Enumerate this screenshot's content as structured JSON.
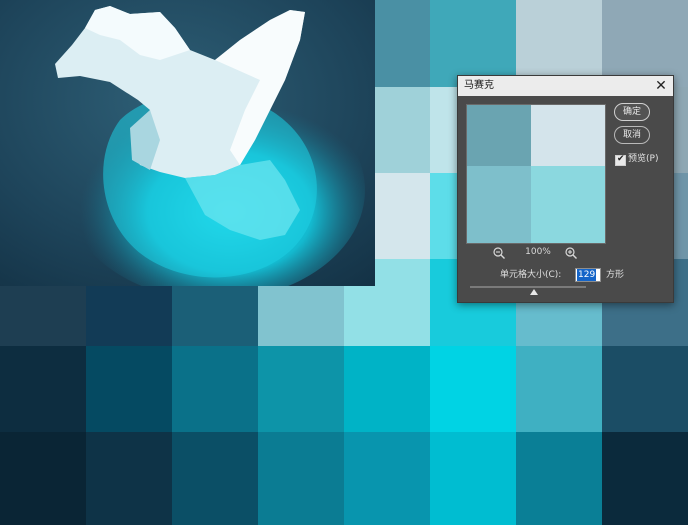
{
  "dialog": {
    "title": "马赛克",
    "ok_label": "确定",
    "cancel_label": "取消",
    "preview_checkbox": {
      "label": "预览(P)",
      "checked": true
    },
    "zoom_level": "100%",
    "cell_size": {
      "label": "单元格大小(C):",
      "value": "129",
      "unit": "方形"
    },
    "slider": {
      "fraction": 0.55
    }
  },
  "icons": {
    "close": "close-icon",
    "zoom_out": "zoom-out-icon",
    "zoom_in": "zoom-in-icon",
    "checkmark": "checkmark-icon"
  },
  "canvas": {
    "mosaic_colors": [
      [
        "#3a6a7e",
        "#2f6478",
        "#2f6478",
        "#3a7a8c",
        "#4a90a4",
        "#3fa8b9",
        "#bad0d8",
        "#8fa8b6"
      ],
      [
        "#30596c",
        "#2c5a70",
        "#2d6175",
        "#3a7586",
        "#9fd1d9",
        "#bfe4ea",
        "#6ac9d6",
        "#8ea7b3"
      ],
      [
        "#2a4f63",
        "#2a5368",
        "#2c5d72",
        "#418090",
        "#d4e6ec",
        "#5ddde9",
        "#75c9d6",
        "#6f95a8"
      ],
      [
        "#1e3e52",
        "#123b56",
        "#1b5f77",
        "#81c3cf",
        "#92e0e6",
        "#18cbdc",
        "#66bccd",
        "#3d6f88"
      ],
      [
        "#0d2d40",
        "#054a62",
        "#0a7189",
        "#0d94a8",
        "#00b3c6",
        "#00d3e4",
        "#3fb0c2",
        "#1b4d65"
      ],
      [
        "#0a2535",
        "#0e3347",
        "#0b4f66",
        "#0b7c93",
        "#0895ae",
        "#00bdd1",
        "#0a7f96",
        "#0b2a3c"
      ]
    ],
    "preview_colors": [
      "#6aa4b1",
      "#d4e4eb",
      "#7ebfcb",
      "#8bd8df"
    ]
  }
}
